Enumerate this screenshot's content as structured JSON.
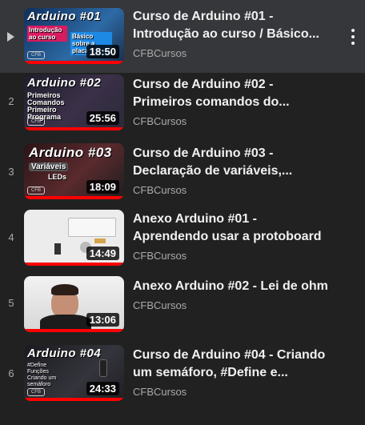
{
  "playlist": {
    "items": [
      {
        "index": "",
        "active": true,
        "title": "Curso de Arduino #01 - Introdução ao curso / Básico...",
        "channel": "CFBCursos",
        "duration": "18:50",
        "thumb_title": "Arduino #01",
        "thumb_sub": "Introdução ao curso / Básico sobre a placa",
        "thumb_bg": "#1c3d6b"
      },
      {
        "index": "2",
        "active": false,
        "title": "Curso de Arduino #02 - Primeiros comandos do...",
        "channel": "CFBCursos",
        "duration": "25:56",
        "thumb_title": "Arduino #02",
        "thumb_sub": "Primeiros Comandos Primeiro Programa",
        "thumb_bg": "#2b2b3a"
      },
      {
        "index": "3",
        "active": false,
        "title": "Curso de Arduino #03 - Declaração de variáveis,...",
        "channel": "CFBCursos",
        "duration": "18:09",
        "thumb_title": "Arduino #03",
        "thumb_sub": "Variáveis LEDs",
        "thumb_bg": "#3a2426"
      },
      {
        "index": "4",
        "active": false,
        "title": "Anexo Arduino #01 - Aprendendo usar a protoboard",
        "channel": "CFBCursos",
        "duration": "14:49",
        "thumb_title": "",
        "thumb_sub": "",
        "thumb_bg": "#e6e6e6"
      },
      {
        "index": "5",
        "active": false,
        "title": "Anexo Arduino #02 - Lei de ohm",
        "channel": "CFBCursos",
        "duration": "13:06",
        "thumb_title": "",
        "thumb_sub": "",
        "thumb_bg": "#dcdcdc"
      },
      {
        "index": "6",
        "active": false,
        "title": "Curso de Arduino #04 - Criando um semáforo, #Define e...",
        "channel": "CFBCursos",
        "duration": "24:33",
        "thumb_title": "Arduino #04",
        "thumb_sub": "#Define Funções Criando um semáforo",
        "thumb_bg": "#2a2a30"
      }
    ]
  },
  "colors": {
    "background": "#212121",
    "active_row": "#36373a",
    "progress": "#ff0000",
    "secondary_text": "#aaaaaa"
  },
  "icons": {
    "now_playing": "play-triangle-icon",
    "more": "kebab-menu-icon"
  }
}
